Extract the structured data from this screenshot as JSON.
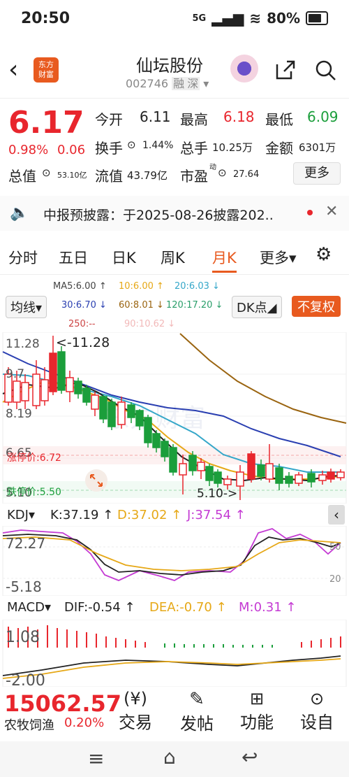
{
  "status": {
    "time": "20:50",
    "network": "5G",
    "battery": "80%"
  },
  "header": {
    "name": "仙坛股份",
    "code": "002746",
    "tag_rong": "融",
    "tag_shen": "深",
    "logo_line1": "东方",
    "logo_line2": "财富"
  },
  "quote": {
    "price": "6.17",
    "pct": "0.98%",
    "chg": "0.06",
    "open_l": "今开",
    "open_v": "6.11",
    "high_l": "最高",
    "high_v": "6.18",
    "low_l": "最低",
    "low_v": "6.09",
    "turn_l": "换手",
    "turn_v": "1.44%",
    "vol_l": "总手",
    "vol_v": "10.25万",
    "amt_l": "金额",
    "amt_v": "6301万",
    "mcap_l": "总值",
    "mcap_v": "53.10亿",
    "float_l": "流值",
    "float_v": "43.79亿",
    "pe_l": "市盈",
    "pe_sup": "动",
    "pe_v": "27.64",
    "more": "更多"
  },
  "notice": {
    "text": "中报预披露：于2025-08-26披露202..",
    "close": "✕"
  },
  "tabs": [
    "分时",
    "五日",
    "日K",
    "周K",
    "月K",
    "更多▾"
  ],
  "active_tab": "月K",
  "ma_bar": {
    "avg": "均线▾",
    "ma5": "MA5:6.00 ↑",
    "ma10": "10:6.00 ↑",
    "ma20": "20:6.03 ↓",
    "ma30": "30:6.70 ↓",
    "ma60": "60:8.01 ↓",
    "ma120": "120:17.20 ↓",
    "ma250": "250:--",
    "ma90": "90:10.62 ↓",
    "dk": "DK点◢",
    "fq": "不复权"
  },
  "chart": {
    "ylab_top": "11.28",
    "ylab_2": "9.7",
    "ylab_3": "8.19",
    "ylab_4": "6.65",
    "ylab_bot": "5.10",
    "max_label": "<-11.28",
    "min_label": "5.10->",
    "limit_up": "涨停价:6.72",
    "limit_down": "跌停价:5.50",
    "watermark": "东方财富"
  },
  "kdj": {
    "name": "KDJ▾",
    "k": "K:37.19 ↑",
    "d": "D:37.02 ↑",
    "j": "J:37.54 ↑",
    "top": "72.27",
    "bot": "-5.18",
    "r50": "50",
    "r20": "20"
  },
  "macd": {
    "name": "MACD▾",
    "dif": "DIF:-0.54 ↑",
    "dea": "DEA:-0.70 ↑",
    "m": "M:0.31 ↑",
    "top": "1.08",
    "bot": "-2.00"
  },
  "bottom": {
    "index": "15062.57",
    "sector": "农牧饲渔",
    "sector_pct": "0.20%",
    "nav": [
      "交易",
      "发帖",
      "功能",
      "设自"
    ]
  },
  "colors": {
    "up": "#e8262d",
    "down": "#1b9e3b",
    "accent": "#e85a1f"
  }
}
